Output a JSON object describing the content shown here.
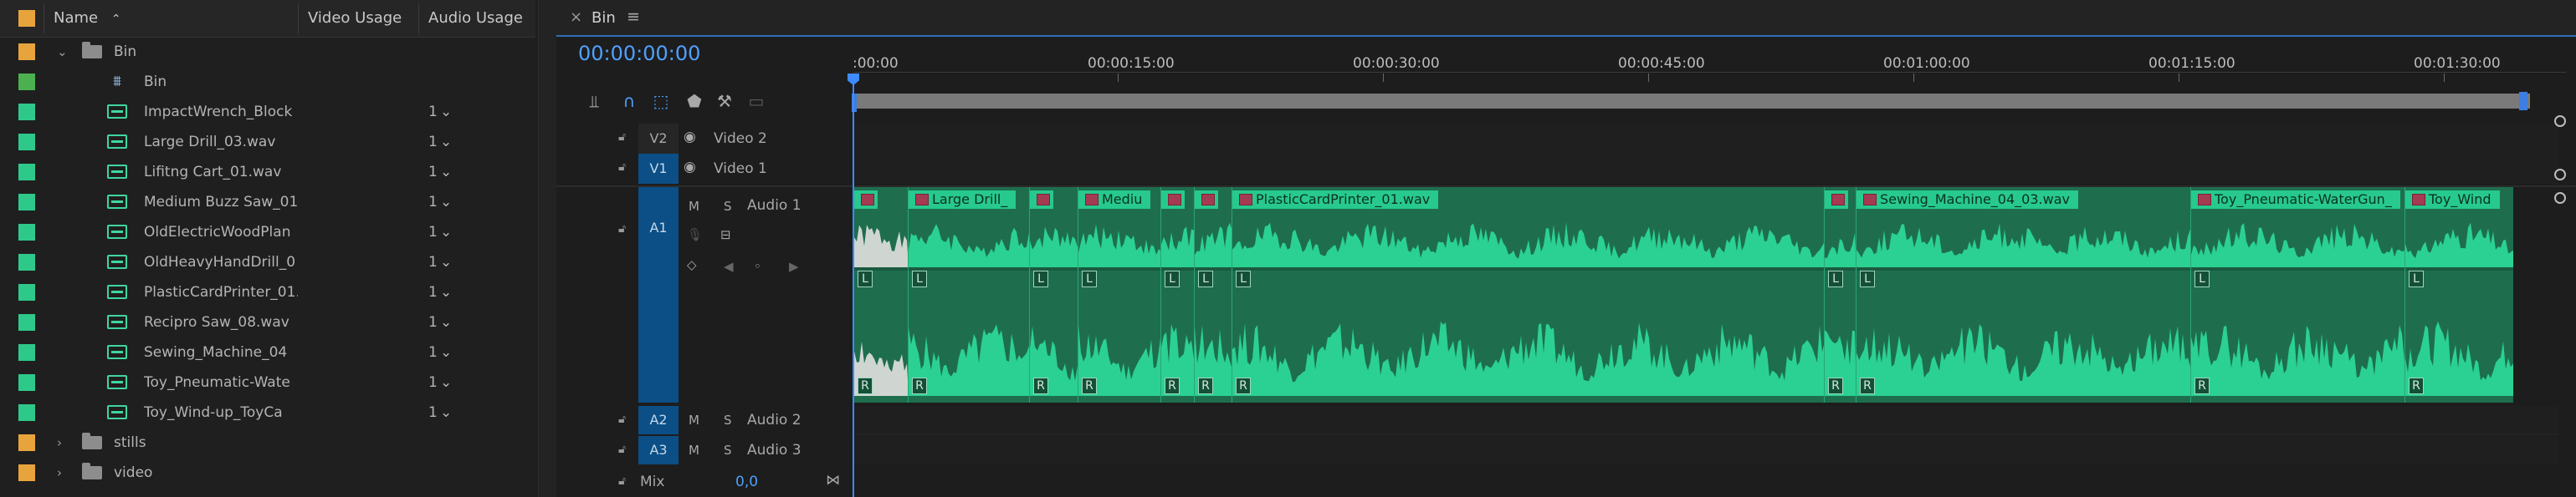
{
  "project_panel": {
    "columns": {
      "name": "Name",
      "video_usage": "Video Usage",
      "audio_usage": "Audio Usage"
    },
    "rows": [
      {
        "type": "folder",
        "label_color": "#e8a43c",
        "name": "Bin",
        "expanded": true,
        "indent": 0,
        "audio_usage": ""
      },
      {
        "type": "sequence",
        "label_color": "#4caf50",
        "name": "Bin",
        "indent": 1,
        "audio_usage": ""
      },
      {
        "type": "audio",
        "label_color": "#2ec98a",
        "name": "ImpactWrench_Block",
        "indent": 1,
        "audio_usage": "1"
      },
      {
        "type": "audio",
        "label_color": "#2ec98a",
        "name": "Large Drill_03.wav",
        "indent": 1,
        "audio_usage": "1"
      },
      {
        "type": "audio",
        "label_color": "#2ec98a",
        "name": "Lifitng Cart_01.wav",
        "indent": 1,
        "audio_usage": "1"
      },
      {
        "type": "audio",
        "label_color": "#2ec98a",
        "name": "Medium Buzz Saw_01",
        "indent": 1,
        "audio_usage": "1"
      },
      {
        "type": "audio",
        "label_color": "#2ec98a",
        "name": "OldElectricWoodPlan",
        "indent": 1,
        "audio_usage": "1"
      },
      {
        "type": "audio",
        "label_color": "#2ec98a",
        "name": "OldHeavyHandDrill_0",
        "indent": 1,
        "audio_usage": "1"
      },
      {
        "type": "audio",
        "label_color": "#2ec98a",
        "name": "PlasticCardPrinter_01.",
        "indent": 1,
        "audio_usage": "1"
      },
      {
        "type": "audio",
        "label_color": "#2ec98a",
        "name": "Recipro Saw_08.wav",
        "indent": 1,
        "audio_usage": "1"
      },
      {
        "type": "audio",
        "label_color": "#2ec98a",
        "name": "Sewing_Machine_04",
        "indent": 1,
        "audio_usage": "1"
      },
      {
        "type": "audio",
        "label_color": "#2ec98a",
        "name": "Toy_Pneumatic-Wate",
        "indent": 1,
        "audio_usage": "1"
      },
      {
        "type": "audio",
        "label_color": "#2ec98a",
        "name": "Toy_Wind-up_ToyCa",
        "indent": 1,
        "audio_usage": "1"
      },
      {
        "type": "folder",
        "label_color": "#e8a43c",
        "name": "stills",
        "expanded": false,
        "indent": 0,
        "audio_usage": ""
      },
      {
        "type": "folder",
        "label_color": "#e8a43c",
        "name": "video",
        "expanded": false,
        "indent": 0,
        "audio_usage": ""
      }
    ]
  },
  "timeline": {
    "tab_title": "Bin",
    "close_glyph": "×",
    "menu_glyph": "≡",
    "timecode": "00:00:00:00",
    "ruler_labels": [
      ":00:00",
      "00:00:15:00",
      "00:00:30:00",
      "00:00:45:00",
      "00:01:00:00",
      "00:01:15:00",
      "00:01:30:00"
    ],
    "tracks": {
      "v2": {
        "target": "V2",
        "name": "Video 2"
      },
      "v1": {
        "target": "V1",
        "name": "Video 1"
      },
      "a1": {
        "target": "A1",
        "name": "Audio 1",
        "mute": "M",
        "solo": "S"
      },
      "a2": {
        "target": "A2",
        "name": "Audio 2",
        "mute": "M",
        "solo": "S"
      },
      "a3": {
        "target": "A3",
        "name": "Audio 3",
        "mute": "M",
        "solo": "S"
      },
      "mix": {
        "name": "Mix",
        "value": "0,0"
      }
    },
    "clips": [
      {
        "name": "",
        "start": 0.0,
        "end": 0.033
      },
      {
        "name": "Large Drill_",
        "start": 0.033,
        "end": 0.106
      },
      {
        "name": "",
        "start": 0.106,
        "end": 0.135
      },
      {
        "name": "Mediu",
        "start": 0.135,
        "end": 0.185
      },
      {
        "name": "",
        "start": 0.185,
        "end": 0.205
      },
      {
        "name": "",
        "start": 0.205,
        "end": 0.228
      },
      {
        "name": "PlasticCardPrinter_01.wav",
        "start": 0.228,
        "end": 0.585
      },
      {
        "name": "",
        "start": 0.585,
        "end": 0.604
      },
      {
        "name": "Sewing_Machine_04_03.wav",
        "start": 0.604,
        "end": 0.806
      },
      {
        "name": "Toy_Pneumatic-WaterGun_",
        "start": 0.806,
        "end": 0.935
      },
      {
        "name": "Toy_Wind",
        "start": 0.935,
        "end": 1.0
      }
    ],
    "channel_labels": {
      "left": "L",
      "right": "R"
    },
    "colors": {
      "accent": "#4fa0ff",
      "clip_body": "#1e6e4e",
      "clip_header": "#27c98e",
      "waveform": "#2bd192",
      "target": "#0b4f86"
    }
  }
}
